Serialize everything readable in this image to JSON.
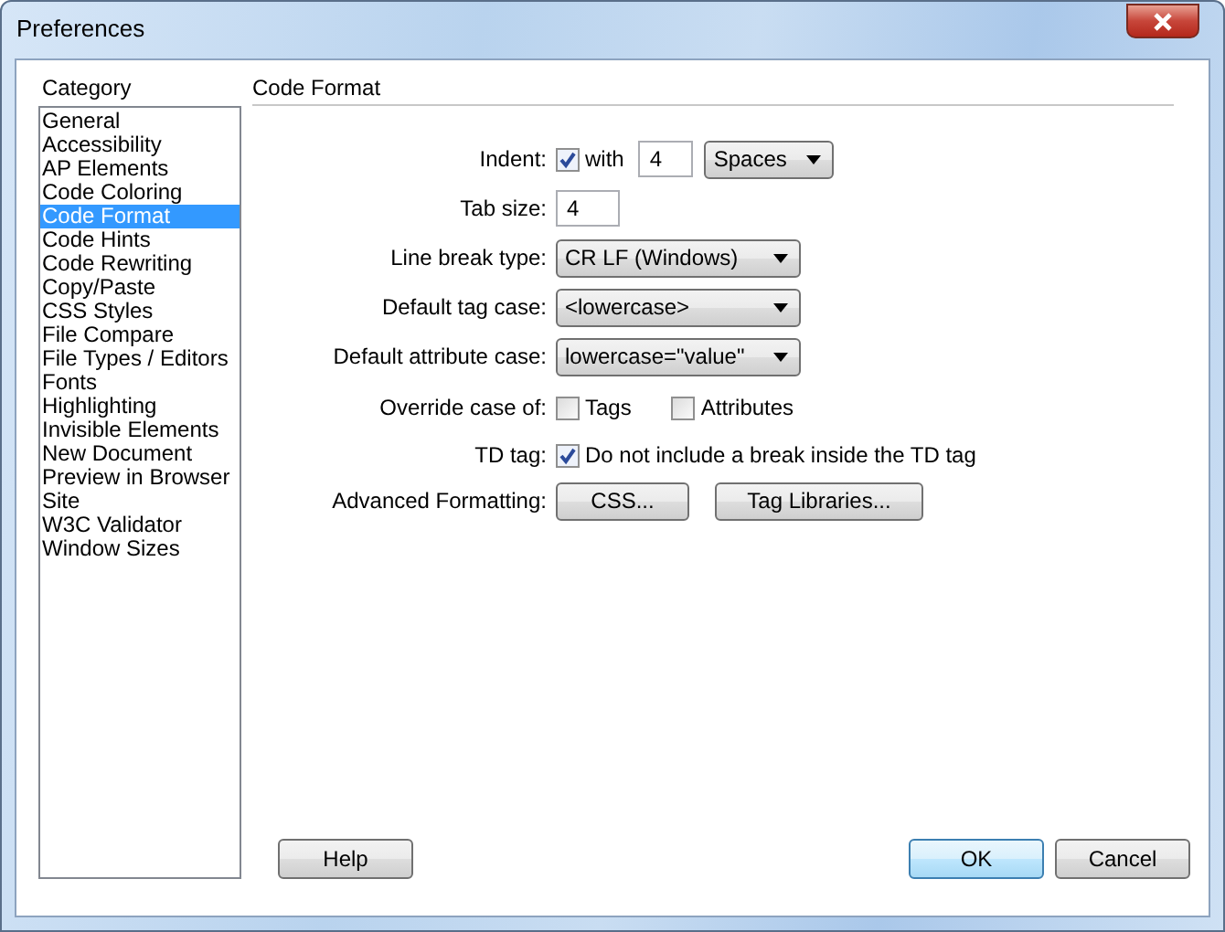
{
  "window": {
    "title": "Preferences"
  },
  "category_label": "Category",
  "categories": [
    {
      "label": "General",
      "selected": false
    },
    {
      "label": "Accessibility",
      "selected": false
    },
    {
      "label": "AP Elements",
      "selected": false
    },
    {
      "label": "Code Coloring",
      "selected": false
    },
    {
      "label": "Code Format",
      "selected": true
    },
    {
      "label": "Code Hints",
      "selected": false
    },
    {
      "label": "Code Rewriting",
      "selected": false
    },
    {
      "label": "Copy/Paste",
      "selected": false
    },
    {
      "label": "CSS Styles",
      "selected": false
    },
    {
      "label": "File Compare",
      "selected": false
    },
    {
      "label": "File Types / Editors",
      "selected": false
    },
    {
      "label": "Fonts",
      "selected": false
    },
    {
      "label": "Highlighting",
      "selected": false
    },
    {
      "label": "Invisible Elements",
      "selected": false
    },
    {
      "label": "New Document",
      "selected": false
    },
    {
      "label": "Preview in Browser",
      "selected": false
    },
    {
      "label": "Site",
      "selected": false
    },
    {
      "label": "W3C Validator",
      "selected": false
    },
    {
      "label": "Window Sizes",
      "selected": false
    }
  ],
  "panel_title": "Code Format",
  "rows": [
    {
      "kind": "indent",
      "label": "Indent:",
      "checked": true,
      "checkbox_label": "with",
      "value": "4",
      "unit": "Spaces"
    },
    {
      "kind": "input",
      "label": "Tab size:",
      "value": "4"
    },
    {
      "kind": "select",
      "label": "Line break type:",
      "value": "CR LF (Windows)"
    },
    {
      "kind": "select",
      "label": "Default tag case:",
      "value": "<lowercase>"
    },
    {
      "kind": "select",
      "label": "Default attribute case:",
      "value": "lowercase=\"value\""
    },
    {
      "kind": "checkboxes",
      "label": "Override case of:",
      "options": [
        {
          "label": "Tags",
          "checked": false
        },
        {
          "label": "Attributes",
          "checked": false
        }
      ]
    },
    {
      "kind": "checkbox",
      "label": "TD tag:",
      "checked": true,
      "text": "Do not include a break inside the TD tag"
    },
    {
      "kind": "buttons",
      "label": "Advanced Formatting:",
      "buttons": [
        "CSS...",
        "Tag Libraries..."
      ]
    }
  ],
  "footer": {
    "help": "Help",
    "ok": "OK",
    "cancel": "Cancel"
  }
}
